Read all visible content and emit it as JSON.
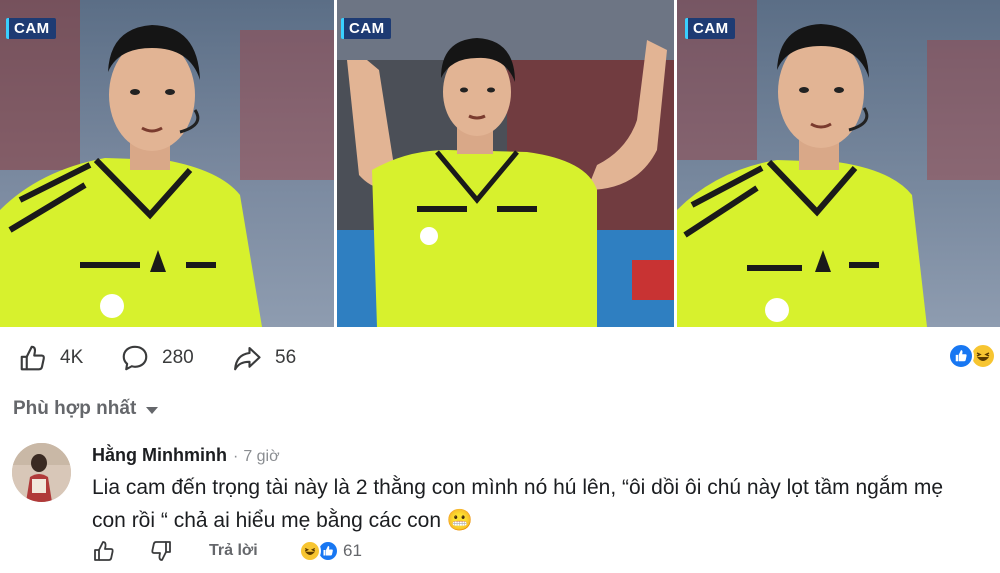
{
  "photos": [
    {
      "badge": "CAM"
    },
    {
      "badge": "CAM"
    },
    {
      "badge": "CAM"
    }
  ],
  "stats": {
    "likes": "4K",
    "comments": "280",
    "shares": "56"
  },
  "post_reactions": [
    "like-icon",
    "haha-icon"
  ],
  "sort": {
    "label": "Phù hợp nhất"
  },
  "comment": {
    "author": "Hằng Minhminh",
    "separator": "·",
    "time": "7 giờ",
    "text": "Lia cam đến trọng tài này là 2 thằng con mình nó hú lên, “ôi dồi ôi chú này lọt tầm ngắm mẹ con rồi “ chả ai hiểu mẹ bằng các con 😬",
    "reply_label": "Trả lời",
    "reaction_count": "61",
    "reactions": [
      "haha-icon",
      "like-icon"
    ]
  },
  "colors": {
    "jersey": "#d7f12d",
    "badge_bg": "#1e3b73",
    "like_blue": "#1877f2",
    "text_muted": "#65676b"
  }
}
